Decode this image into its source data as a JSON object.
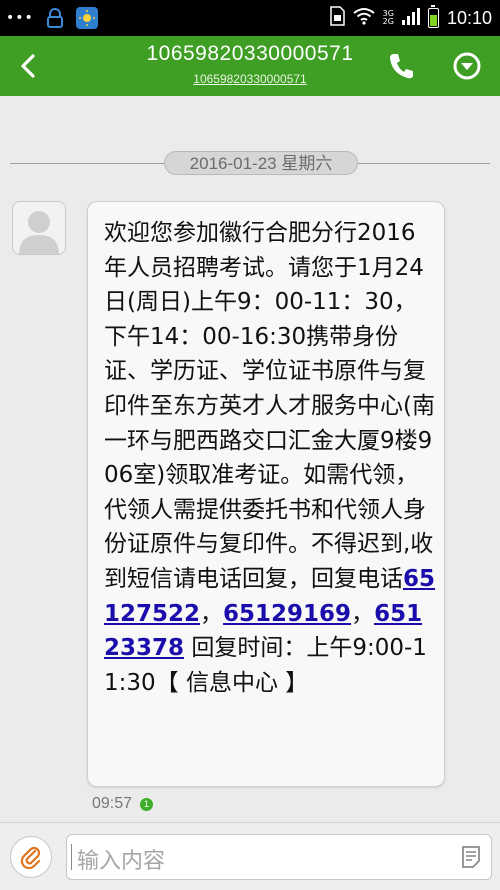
{
  "status_bar": {
    "dots": "•••",
    "time": "10:10",
    "network_top": "3G",
    "network_bottom": "2G"
  },
  "header": {
    "title": "10659820330000571",
    "subtitle": "10659820330000571"
  },
  "date_separator": "2016-01-23 星期六",
  "message": {
    "text_before": "欢迎您参加徽行合肥分行2016年人员招聘考试。请您于1月24日(周日)上午9：00-11：30，下午14：00-16:30携带身份证、学历证、学位证书原件与复印件至东方英才人才服务中心(南一环与肥西路交口汇金大厦9楼906室)领取准考证。如需代领，代领人需提供委托书和代领人身份证原件与复印件。不得迟到,收到短信请电话回复，回复电话",
    "phone1": "65127522",
    "sep1": "，",
    "phone2": "65129169",
    "sep2": "，",
    "phone3": "65123378",
    "text_after": " 回复时间：上午9:00-11:30【 信息中心 】",
    "time": "09:57",
    "sim_slot": "1"
  },
  "composer": {
    "placeholder": "输入内容"
  },
  "colors": {
    "header_green": "#3f9e24",
    "link_blue": "#1a0dab",
    "background": "#ebebeb"
  },
  "icons": [
    "back-icon",
    "phone-icon",
    "dropdown-menu-icon",
    "paperclip-icon",
    "template-icon",
    "lock-icon",
    "weather-icon",
    "wifi-icon",
    "battery-icon"
  ]
}
